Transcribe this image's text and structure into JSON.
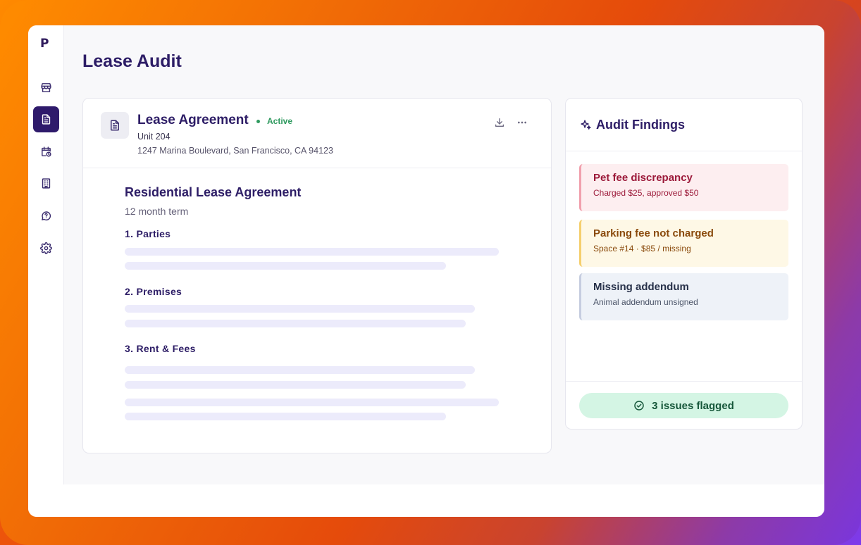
{
  "app": {
    "logo_text": "P",
    "page_title": "Lease Audit"
  },
  "sidebar": {
    "items": [
      {
        "icon": "storefront-icon",
        "active": false
      },
      {
        "icon": "document-icon",
        "active": true
      },
      {
        "icon": "calendar-clock-icon",
        "active": false
      },
      {
        "icon": "building-icon",
        "active": false
      },
      {
        "icon": "help-chat-icon",
        "active": false
      },
      {
        "icon": "gear-icon",
        "active": false
      }
    ]
  },
  "document": {
    "title": "Lease Agreement",
    "status": "Active",
    "unit": "Unit 204",
    "address": "1247 Marina Boulevard, San Francisco, CA 94123",
    "actions": [
      "download-icon",
      "more-icon"
    ],
    "body": {
      "title": "Residential Lease Agreement",
      "subtitle": "12 month term",
      "sections": [
        {
          "heading": "1. Parties"
        },
        {
          "heading": "2. Premises"
        },
        {
          "heading": "3. Rent & Fees"
        }
      ]
    }
  },
  "findings": {
    "title": "Audit Findings",
    "items": [
      {
        "title": "Pet fee discrepancy",
        "desc": "Charged $25, approved $50",
        "severity": "high",
        "color": "#9c1a3a"
      },
      {
        "title": "Parking fee not charged",
        "desc": "Space #14 · $85 / missing",
        "severity": "medium",
        "color": "#8a4a0c"
      },
      {
        "title": "Missing addendum",
        "desc": "Animal addendum unsigned",
        "severity": "low",
        "color": "#27314a"
      }
    ],
    "summary": "3 issues flagged"
  },
  "colors": {
    "accent": "#2e1a6b",
    "active_status": "#2f9a5f",
    "summary_bg": "#d4f5e4"
  }
}
